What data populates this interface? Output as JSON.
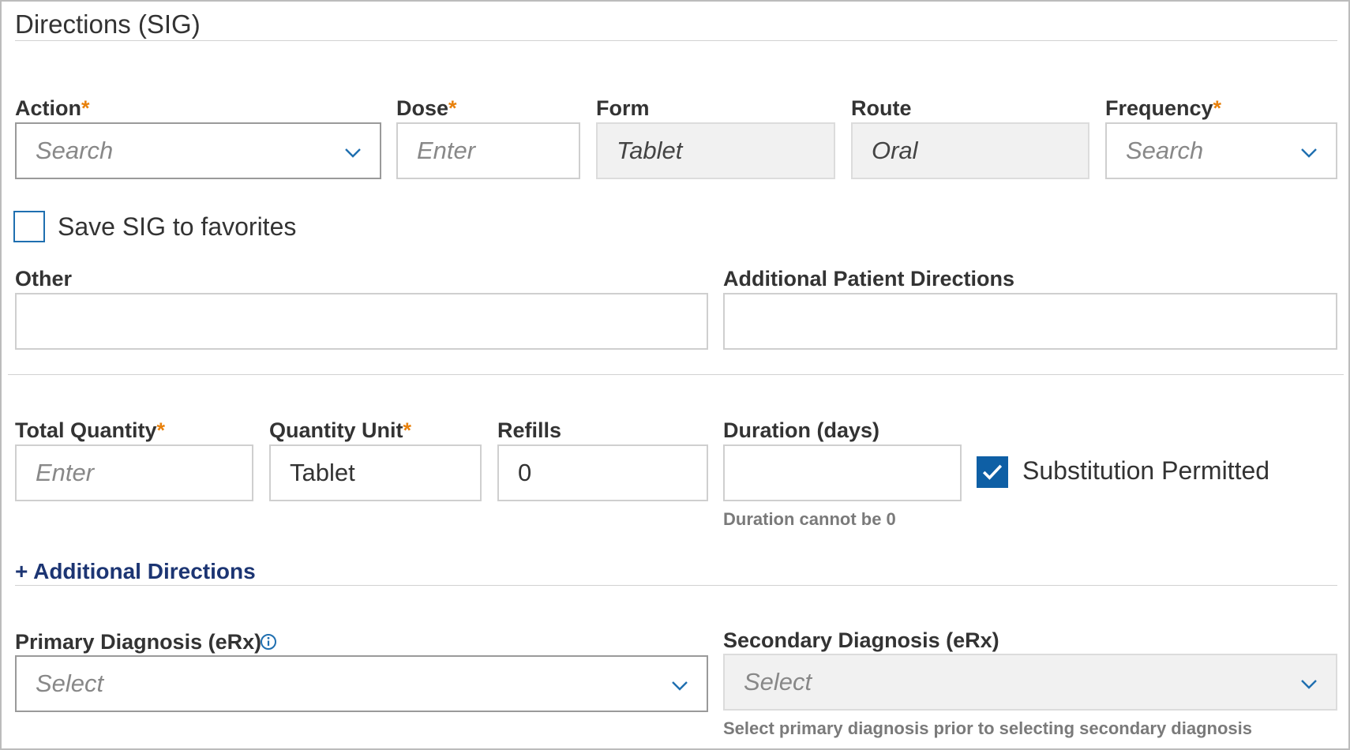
{
  "section": {
    "title": "Directions (SIG)"
  },
  "sig": {
    "action": {
      "label": "Action",
      "required": "*",
      "placeholder": "Search"
    },
    "dose": {
      "label": "Dose",
      "required": "*",
      "placeholder": "Enter"
    },
    "form": {
      "label": "Form",
      "value": "Tablet"
    },
    "route": {
      "label": "Route",
      "value": "Oral"
    },
    "frequency": {
      "label": "Frequency",
      "required": "*",
      "placeholder": "Search"
    },
    "save_favorites": {
      "label": "Save SIG to favorites",
      "checked": false
    },
    "other": {
      "label": "Other",
      "value": ""
    },
    "additional_patient_directions": {
      "label": "Additional Patient Directions",
      "value": ""
    }
  },
  "quantity": {
    "total_quantity": {
      "label": "Total Quantity",
      "required": "*",
      "placeholder": "Enter"
    },
    "quantity_unit": {
      "label": "Quantity Unit",
      "required": "*",
      "value": "Tablet"
    },
    "refills": {
      "label": "Refills",
      "value": "0"
    },
    "duration": {
      "label": "Duration (days)",
      "value": "",
      "hint": "Duration cannot be 0"
    },
    "substitution": {
      "label": "Substitution Permitted",
      "checked": true
    }
  },
  "additional_directions": {
    "link": "+ Additional Directions"
  },
  "diagnosis": {
    "primary": {
      "label": "Primary Diagnosis (eRx)",
      "placeholder": "Select"
    },
    "secondary": {
      "label": "Secondary Diagnosis (eRx)",
      "placeholder": "Select",
      "hint": "Select primary diagnosis prior to selecting secondary diagnosis"
    }
  },
  "colors": {
    "accent": "#0e5fa5",
    "required": "#e8810c",
    "link": "#1c3573",
    "chevron": "#1f6fb0"
  }
}
